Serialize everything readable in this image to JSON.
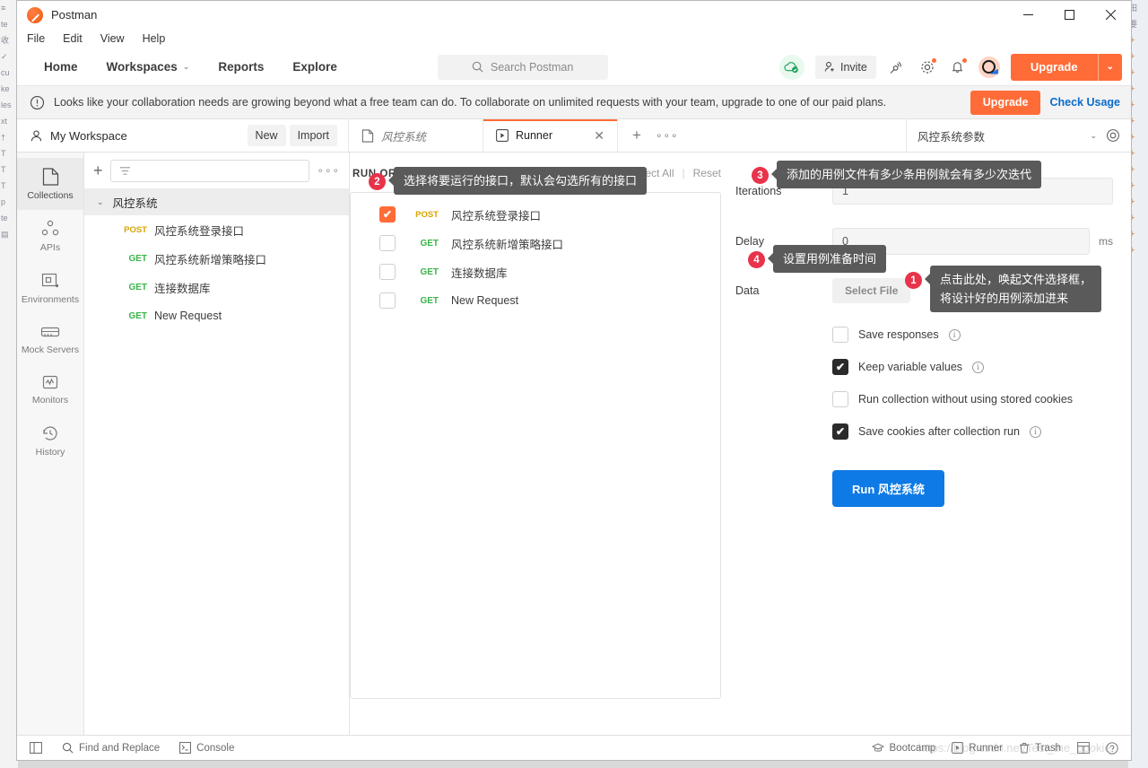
{
  "window": {
    "app_title": "Postman",
    "controls": {
      "minimize": "—",
      "maximize": "▢",
      "close": "✕"
    }
  },
  "menubar": {
    "items": [
      "File",
      "Edit",
      "View",
      "Help"
    ]
  },
  "header": {
    "nav": [
      {
        "label": "Home",
        "caret": false
      },
      {
        "label": "Workspaces",
        "caret": true
      },
      {
        "label": "Reports",
        "caret": false
      },
      {
        "label": "Explore",
        "caret": false
      }
    ],
    "search": {
      "placeholder": "Search Postman"
    },
    "invite_label": "Invite",
    "upgrade_label": "Upgrade",
    "upgrade_caret": "⌄"
  },
  "banner": {
    "text": "Looks like your collaboration needs are growing beyond what a free team can do. To collaborate on unlimited requests with your team, upgrade to one of our paid plans.",
    "upgrade_label": "Upgrade",
    "check_usage_label": "Check Usage"
  },
  "workspace": {
    "name": "My Workspace",
    "new_label": "New",
    "import_label": "Import"
  },
  "tabs": [
    {
      "label": "风控系统",
      "icon": "collection-icon",
      "active": false,
      "closable": false
    },
    {
      "label": "Runner",
      "icon": "runner-icon",
      "active": true,
      "closable": true
    }
  ],
  "tab_add": {
    "plus": "+",
    "more": "∘∘∘"
  },
  "environment": {
    "selected": "风控系统参数",
    "caret": "⌄"
  },
  "sidebar": {
    "items": [
      {
        "label": "Collections",
        "icon": "collections-icon",
        "active": true
      },
      {
        "label": "APIs",
        "icon": "apis-icon",
        "active": false
      },
      {
        "label": "Environments",
        "icon": "environments-icon",
        "active": false
      },
      {
        "label": "Mock Servers",
        "icon": "mock-servers-icon",
        "active": false
      },
      {
        "label": "Monitors",
        "icon": "monitors-icon",
        "active": false
      },
      {
        "label": "History",
        "icon": "history-icon",
        "active": false
      }
    ]
  },
  "collections": {
    "filter_placeholder": "",
    "more_label": "∘∘∘",
    "root": {
      "label": "风控系统",
      "expanded": true
    },
    "requests": [
      {
        "method": "POST",
        "name": "风控系统登录接口"
      },
      {
        "method": "GET",
        "name": "风控系统新增策略接口"
      },
      {
        "method": "GET",
        "name": "连接数据库"
      },
      {
        "method": "GET",
        "name": "New Request"
      }
    ]
  },
  "runner": {
    "run_order_title": "RUN ORDER",
    "actions": [
      "Deselect All",
      "Select All",
      "Reset"
    ],
    "items": [
      {
        "method": "POST",
        "name": "风控系统登录接口",
        "checked": true
      },
      {
        "method": "GET",
        "name": "风控系统新增策略接口",
        "checked": false
      },
      {
        "method": "GET",
        "name": "连接数据库",
        "checked": false
      },
      {
        "method": "GET",
        "name": "New Request",
        "checked": false
      }
    ],
    "fields": {
      "iterations": {
        "label": "Iterations",
        "value": "1"
      },
      "delay": {
        "label": "Delay",
        "value": "0",
        "unit": "ms"
      },
      "data": {
        "label": "Data",
        "button": "Select File"
      }
    },
    "options": [
      {
        "label": "Save responses",
        "checked": false,
        "info": true
      },
      {
        "label": "Keep variable values",
        "checked": true,
        "info": true
      },
      {
        "label": "Run collection without using stored cookies",
        "checked": false,
        "info": false
      },
      {
        "label": "Save cookies after collection run",
        "checked": true,
        "info": true
      }
    ],
    "run_button": "Run 风控系统"
  },
  "tooltips": [
    {
      "number": "1",
      "text": "点击此处，唤起文件选择框，\n将设计好的用例添加进来"
    },
    {
      "number": "2",
      "text": "选择将要运行的接口，默认会勾选所有的接口"
    },
    {
      "number": "3",
      "text": "添加的用例文件有多少条用例就会有多少次迭代"
    },
    {
      "number": "4",
      "text": "设置用例准备时间"
    }
  ],
  "statusbar": {
    "left": [
      {
        "label": "",
        "icon": "sidebar-toggle-icon"
      },
      {
        "label": "Find and Replace",
        "icon": "search-icon"
      },
      {
        "label": "Console",
        "icon": "console-icon"
      }
    ],
    "right": [
      {
        "label": "Bootcamp",
        "icon": "bootcamp-icon"
      },
      {
        "label": "Runner",
        "icon": "runner-icon"
      },
      {
        "label": "Trash",
        "icon": "trash-icon"
      },
      {
        "label": "",
        "icon": "layout-icon"
      },
      {
        "label": "",
        "icon": "help-icon"
      }
    ]
  },
  "watermark": "https://blog.csdn.net/Test_the_bookie",
  "colors": {
    "accent": "#ff6c37",
    "link": "#0b6bcb",
    "run_button": "#0e7ae5",
    "badge": "#e8334a",
    "tooltip_bg": "#5a5a5a",
    "method_post": "#dba400",
    "method_get": "#3bb44a"
  },
  "background_edges": {
    "left": [
      "≡",
      "te",
      "收",
      "",
      "",
      "✓",
      "",
      "cu",
      "ke",
      "les",
      "xt",
      "†",
      "T",
      "T",
      "T",
      "",
      "p",
      "te",
      "",
      "",
      "",
      "",
      "",
      "▤"
    ],
    "right": [
      "",
      "田",
      "",
      "要",
      "",
      "",
      "",
      "",
      "",
      "",
      "",
      "",
      "",
      "",
      ""
    ]
  }
}
